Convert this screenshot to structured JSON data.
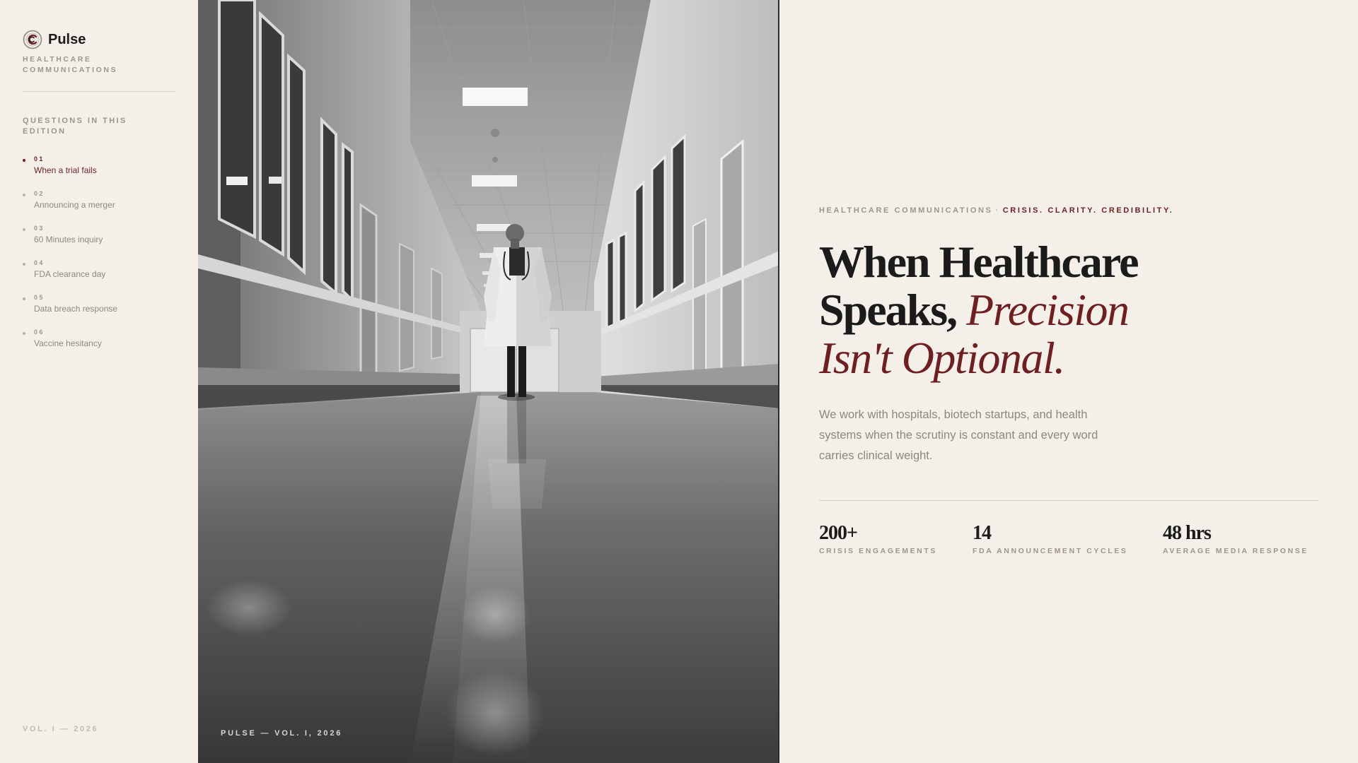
{
  "brand": {
    "name": "Pulse",
    "tagline": "HEALTHCARE COMMUNICATIONS",
    "logo_icon": "pulse-logo-icon"
  },
  "sidebar": {
    "heading": "QUESTIONS IN THIS EDITION",
    "items": [
      {
        "number": "01",
        "label": "When a trial fails",
        "active": true
      },
      {
        "number": "02",
        "label": "Announcing a merger",
        "active": false
      },
      {
        "number": "03",
        "label": "60 Minutes inquiry",
        "active": false
      },
      {
        "number": "04",
        "label": "FDA clearance day",
        "active": false
      },
      {
        "number": "05",
        "label": "Data breach response",
        "active": false
      },
      {
        "number": "06",
        "label": "Vaccine hesitancy",
        "active": false
      }
    ],
    "footer": "VOL. I — 2026"
  },
  "photo": {
    "caption": "PULSE — VOL. I, 2026",
    "subject": "doctor walking down hospital corridor (black and white)"
  },
  "hero": {
    "eyebrow_prefix": "HEALTHCARE COMMUNICATIONS",
    "eyebrow_separator": "·",
    "eyebrow_accent": "CRISIS. CLARITY. CREDIBILITY.",
    "headline_line1": "When Healthcare",
    "headline_line2_plain": "Speaks, ",
    "headline_line2_accent": "Precision",
    "headline_line3_accent": "Isn't Optional.",
    "lede": "We work with hospitals, biotech startups, and health systems when the scrutiny is constant and every word carries clinical weight."
  },
  "stats": [
    {
      "value": "200+",
      "label": "CRISIS ENGAGEMENTS"
    },
    {
      "value": "14",
      "label": "FDA ANNOUNCEMENT CYCLES"
    },
    {
      "value": "48 hrs",
      "label": "AVERAGE MEDIA RESPONSE"
    }
  ],
  "colors": {
    "background": "#f4f0e9",
    "accent": "#6e1f22",
    "text": "#1b1b1b",
    "muted": "#9c958d"
  }
}
